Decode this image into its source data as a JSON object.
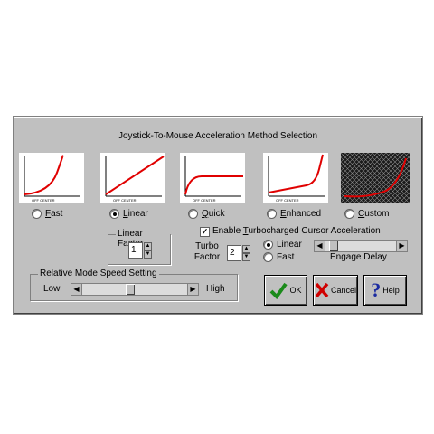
{
  "dialog": {
    "title": "Joystick-To-Mouse Acceleration Method Selection"
  },
  "methods": [
    {
      "label": "Fast",
      "mnemonic": "F",
      "rest": "ast",
      "selected": false
    },
    {
      "label": "Linear",
      "mnemonic": "L",
      "rest": "inear",
      "selected": true
    },
    {
      "label": "Quick",
      "mnemonic": "Q",
      "rest": "uick",
      "selected": false
    },
    {
      "label": "Enhanced",
      "mnemonic": "E",
      "rest": "nhanced",
      "selected": false
    },
    {
      "label": "Custom",
      "mnemonic": "C",
      "rest": "ustom",
      "selected": false
    }
  ],
  "graph": {
    "x_axis_label": "OFF CENTER",
    "curve_color": "#e00000"
  },
  "linear_factor": {
    "label": "Linear Factor",
    "value": "1"
  },
  "turbo": {
    "checkbox_label_pre": "Enable ",
    "checkbox_mnemonic": "T",
    "checkbox_label_post": "urbocharged Cursor Acceleration",
    "checked": true,
    "factor_label_1": "Turbo",
    "factor_label_2": "Factor",
    "factor_value": "2",
    "mode_linear": "Linear",
    "mode_fast": "Fast",
    "mode_linear_selected": true,
    "engage_delay_label": "Engage Delay"
  },
  "relative_speed": {
    "label": "Relative Mode Speed Setting",
    "low": "Low",
    "high": "High"
  },
  "buttons": {
    "ok": "OK",
    "cancel": "Cancel",
    "help": "Help"
  }
}
